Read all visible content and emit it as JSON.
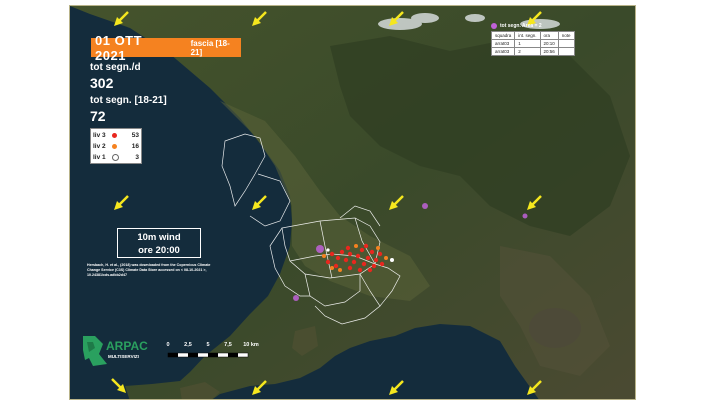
{
  "header": {
    "date": "01 OTT 2021",
    "band": "fascia [18-21]"
  },
  "stats": {
    "total_label": "tot segn./d",
    "total_value": "302",
    "band_label": "tot segn. [18-21]",
    "band_value": "72"
  },
  "legend": [
    {
      "label": "liv 3",
      "color": "#e8271e",
      "count": "53"
    },
    {
      "label": "liv 2",
      "color": "#f58220",
      "count": "16"
    },
    {
      "label": "liv 1",
      "color": "#ffffff",
      "count": "3"
    }
  ],
  "wind": {
    "line1": "10m wind",
    "line2": "ore 20:00",
    "direction": "from north (arrows pointing south-west)",
    "arrow_color": "#f5e71e"
  },
  "credit": "Hersbach, H. et al., (2018) was downloaded from the Copernicus Climate Change Service (C3S) Climate Data Store accessed on < 08-10-2021 >, 10.24381/cds.adbb2d47",
  "area_panel": {
    "title": "tot segn. Area = 2",
    "color": "#c061d8",
    "headers": [
      "squadra",
      "int. segn.",
      "ora",
      "note"
    ],
    "rows": [
      [
        "arrat03",
        "1",
        "20:10",
        ""
      ],
      [
        "arrat03",
        "2",
        "20:56",
        ""
      ]
    ]
  },
  "logo": {
    "name": "ARPAC",
    "subtitle": "MULTISERVIZI"
  },
  "scale": {
    "ticks": [
      "0",
      "2,5",
      "5",
      "7,5",
      "10 km"
    ],
    "tick_values": [
      0,
      2.5,
      5,
      7.5,
      10
    ]
  },
  "colors": {
    "sea": "#142c3c",
    "land": "#3b4a28",
    "title_bg": "#f58220",
    "liv3": "#e8271e",
    "liv2": "#f58220",
    "liv1": "#ffffff"
  }
}
